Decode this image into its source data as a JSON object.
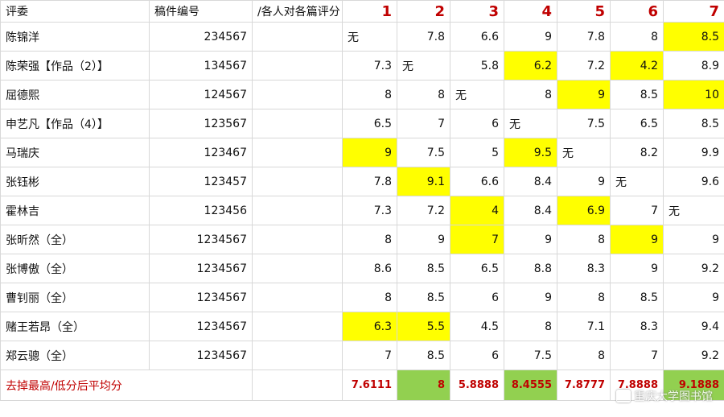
{
  "header": {
    "judge": "评委",
    "manuscript_id": "稿件编号",
    "scores_note": "/各人对各篇评分",
    "columns": [
      "1",
      "2",
      "3",
      "4",
      "5",
      "6",
      "7"
    ]
  },
  "rows": [
    {
      "judge": "陈锦洋",
      "id": "234567",
      "scores": [
        "无",
        "7.8",
        "6.6",
        "9",
        "7.8",
        "8",
        "8.5"
      ],
      "highlight": [
        false,
        false,
        false,
        false,
        false,
        false,
        true
      ]
    },
    {
      "judge": "陈荣强【作品（2）】",
      "id": "134567",
      "scores": [
        "7.3",
        "无",
        "5.8",
        "6.2",
        "7.2",
        "4.2",
        "8.9"
      ],
      "highlight": [
        false,
        false,
        false,
        true,
        false,
        true,
        false
      ]
    },
    {
      "judge": "屈德熙",
      "id": "124567",
      "scores": [
        "8",
        "8",
        "无",
        "8",
        "9",
        "8.5",
        "10"
      ],
      "highlight": [
        false,
        false,
        false,
        false,
        true,
        false,
        true
      ]
    },
    {
      "judge": "申艺凡【作品（4）】",
      "id": "123567",
      "scores": [
        "6.5",
        "7",
        "6",
        "无",
        "7.5",
        "6.5",
        "8.5"
      ],
      "highlight": [
        false,
        false,
        false,
        false,
        false,
        false,
        false
      ]
    },
    {
      "judge": "马瑞庆",
      "id": "123467",
      "scores": [
        "9",
        "7.5",
        "5",
        "9.5",
        "无",
        "8.2",
        "9.9"
      ],
      "highlight": [
        true,
        false,
        false,
        true,
        false,
        false,
        false
      ]
    },
    {
      "judge": "张钰彬",
      "id": "123457",
      "scores": [
        "7.8",
        "9.1",
        "6.6",
        "8.4",
        "9",
        "无",
        "9.6"
      ],
      "highlight": [
        false,
        true,
        false,
        false,
        false,
        false,
        false
      ]
    },
    {
      "judge": "霍林吉",
      "id": "123456",
      "scores": [
        "7.3",
        "7.2",
        "4",
        "8.4",
        "6.9",
        "7",
        "无"
      ],
      "highlight": [
        false,
        false,
        true,
        false,
        true,
        false,
        false
      ]
    },
    {
      "judge": "张昕然（全）",
      "id": "1234567",
      "scores": [
        "8",
        "9",
        "7",
        "9",
        "8",
        "9",
        "9"
      ],
      "highlight": [
        false,
        false,
        true,
        false,
        false,
        true,
        false
      ]
    },
    {
      "judge": "张博傲（全）",
      "id": "1234567",
      "scores": [
        "8.6",
        "8.5",
        "6.5",
        "8.8",
        "8.3",
        "9",
        "9.2"
      ],
      "highlight": [
        false,
        false,
        false,
        false,
        false,
        false,
        false
      ]
    },
    {
      "judge": "曹钊丽（全）",
      "id": "1234567",
      "scores": [
        "8",
        "8.5",
        "6",
        "9",
        "8",
        "8.5",
        "9"
      ],
      "highlight": [
        false,
        false,
        false,
        false,
        false,
        false,
        false
      ]
    },
    {
      "judge": "赌王若昂（全）",
      "id": "1234567",
      "scores": [
        "6.3",
        "5.5",
        "4.5",
        "8",
        "7.1",
        "8.3",
        "9.4"
      ],
      "highlight": [
        true,
        true,
        false,
        false,
        false,
        false,
        false
      ]
    },
    {
      "judge": "郑云骢（全）",
      "id": "1234567",
      "scores": [
        "7",
        "8.5",
        "6",
        "7.5",
        "8",
        "7",
        "9.2"
      ],
      "highlight": [
        false,
        false,
        false,
        false,
        false,
        false,
        false
      ]
    }
  ],
  "average": {
    "label": "去掉最高/低分后平均分",
    "values": [
      "7.6111",
      "8",
      "5.8888",
      "8.4555",
      "7.8777",
      "7.8888",
      "9.1888"
    ],
    "highlight": [
      false,
      true,
      false,
      true,
      false,
      false,
      true
    ]
  },
  "watermark": "重庆大学图书馆",
  "colors": {
    "highlight_yellow": "#ffff00",
    "highlight_green": "#92d050",
    "accent_red": "#c00000"
  }
}
